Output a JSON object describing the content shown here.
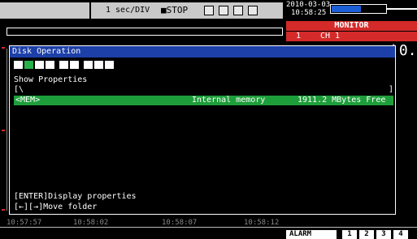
{
  "topbar": {
    "time_div": "1 sec/DIV",
    "stop_label": "STOP",
    "date": "2010-03-03",
    "time": "10:58:25",
    "battery_level": 0.55
  },
  "monitor": {
    "title": "MONITOR",
    "channel_num": "1",
    "channel_label": "CH 1"
  },
  "dialog": {
    "title": "Disk Operation",
    "subtitle": "Show Properties",
    "path": "[\\",
    "path_close": "]",
    "selected_row": {
      "name": "<MEM>",
      "desc": "Internal memory",
      "free": "1911.2 MBytes Free"
    },
    "toolbar_icons": [
      "drive-icon",
      "search-icon",
      "folder-icon",
      "file-icon",
      "copy-icon",
      "delete-icon",
      "rename-icon",
      "new-folder-icon",
      "format-icon"
    ],
    "footer_line1": "[ENTER]Display properties",
    "footer_line2": "[←][→]Move folder"
  },
  "side_value": ")0.",
  "time_axis": [
    "10:57:57",
    "10:58:02",
    "10:58:07",
    "10:58:12"
  ],
  "bottom": {
    "alarm": "ALARM",
    "channels": [
      "1",
      "2",
      "3",
      "4"
    ]
  },
  "colors": {
    "title_blue": "#1c3fa8",
    "select_green": "#1e9e3a",
    "monitor_red": "#d42a2a"
  }
}
